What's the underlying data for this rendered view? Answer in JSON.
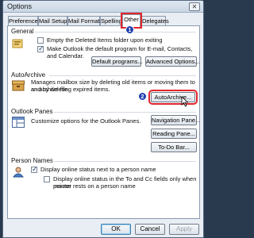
{
  "window": {
    "title": "Options",
    "close_glyph": "✕"
  },
  "tabs": [
    {
      "label": "Preferences"
    },
    {
      "label": "Mail Setup"
    },
    {
      "label": "Mail Format"
    },
    {
      "label": "Spelling"
    },
    {
      "label": "Other",
      "active": true
    },
    {
      "label": "Delegates"
    }
  ],
  "annotations": {
    "step1": "1",
    "step2": "2",
    "highlight_color": "#e0262c",
    "badge_color": "#1f3fb0"
  },
  "general": {
    "title": "General",
    "empty_deleted": {
      "label": "Empty the Deleted Items folder upon exiting",
      "checked": false
    },
    "default_program": {
      "label_line1": "Make Outlook the default program for E-mail, Contacts, and Calendar.",
      "checked": true
    },
    "default_programs_button": "Default programs...",
    "advanced_options_button": "Advanced Options..."
  },
  "autoarchive": {
    "title": "AutoArchive",
    "description_line1": "Manages mailbox size by deleting old items or moving them to an archive file",
    "description_line2": "and by deleting expired items.",
    "button": "AutoArchive..."
  },
  "outlook_panes": {
    "title": "Outlook Panes",
    "description": "Customize options for the Outlook Panes.",
    "navigation_button": "Navigation Pane...",
    "reading_button": "Reading Pane...",
    "todo_button": "To-Do Bar..."
  },
  "person_names": {
    "title": "Person Names",
    "online_status": {
      "label": "Display online status next to a person name",
      "checked": true
    },
    "to_cc": {
      "label_line1": "Display online status in the To and Cc fields only when mouse",
      "label_line2": "pointer rests on a person name",
      "checked": false
    }
  },
  "footer": {
    "ok": "OK",
    "cancel": "Cancel",
    "apply": "Apply"
  }
}
